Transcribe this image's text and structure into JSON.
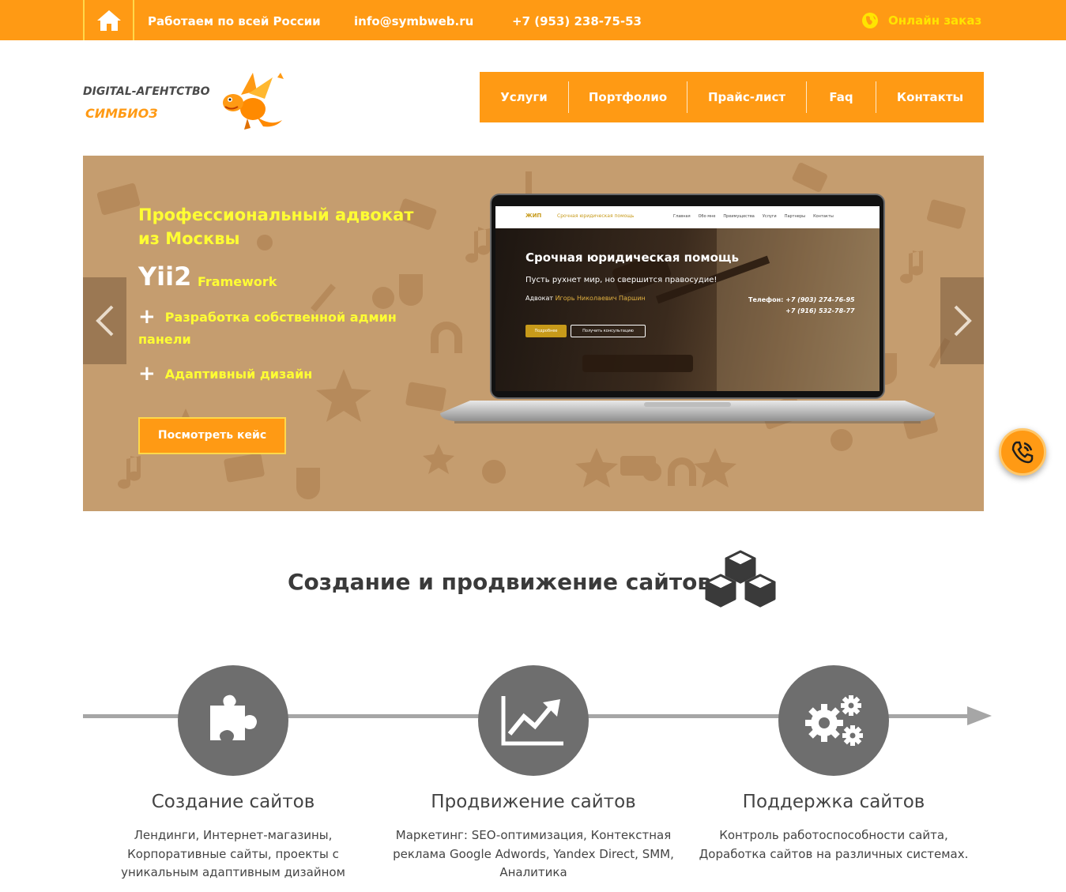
{
  "topbar": {
    "region": "Работаем по всей России",
    "email": "info@symbweb.ru",
    "phone": "+7 (953) 238-75-53",
    "online_order": "Онлайн заказ"
  },
  "logo": {
    "line1": "DIGITAL-АГЕНТСТВО",
    "line2": "СИМБИОЗ"
  },
  "nav": {
    "items": [
      "Услуги",
      "Портфолио",
      "Прайс-лист",
      "Faq",
      "Контакты"
    ]
  },
  "hero": {
    "title": "Профессиональный адвокат из Москвы",
    "tech": "Yii2",
    "tech_sub": "Framework",
    "features": [
      "Разработка собственной админ панели",
      "Адаптивный дизайн"
    ],
    "plus": "+",
    "button": "Посмотреть кейс",
    "screen": {
      "logo": "ЖИП",
      "tagline": "Срочная юридическая помощь",
      "menu": [
        "Главная",
        "Обо мне",
        "Преимущества",
        "Услуги",
        "Партнеры",
        "Контакты"
      ],
      "heading": "Срочная юридическая помощь",
      "subheading": "Пусть рухнет мир, но свершится правосудие!",
      "lawyer_prefix": "Адвокат",
      "lawyer_name": "Игорь Николаевич Паршин",
      "phone_label": "Телефон:",
      "phone1": "+7 (903) 274-76-95",
      "phone2": "+7 (916) 532-78-77",
      "btn_more": "Подробнее",
      "btn_consult": "Получить консультацию"
    }
  },
  "section": {
    "title": "Создание и продвижение сайтов"
  },
  "steps": [
    {
      "title": "Создание сайтов",
      "desc": "Лендинги, Интернет-магазины, Корпоративные сайты, проекты с уникальным адаптивным дизайном",
      "icon": "puzzle-icon"
    },
    {
      "title": "Продвижение сайтов",
      "desc": "Маркетинг: SEO-оптимизация, Контекстная реклама Google Adwords, Yandex Direct, SMM, Аналитика",
      "icon": "growth-chart-icon"
    },
    {
      "title": "Поддержка сайтов",
      "desc": "Контроль работоспособности сайта, Доработка сайтов на различных системах.",
      "icon": "gears-icon"
    }
  ],
  "colors": {
    "accent": "#ff9a14",
    "highlight": "#ffff33",
    "hero_bg": "#c59d6f",
    "circle": "#6e6e6e"
  }
}
